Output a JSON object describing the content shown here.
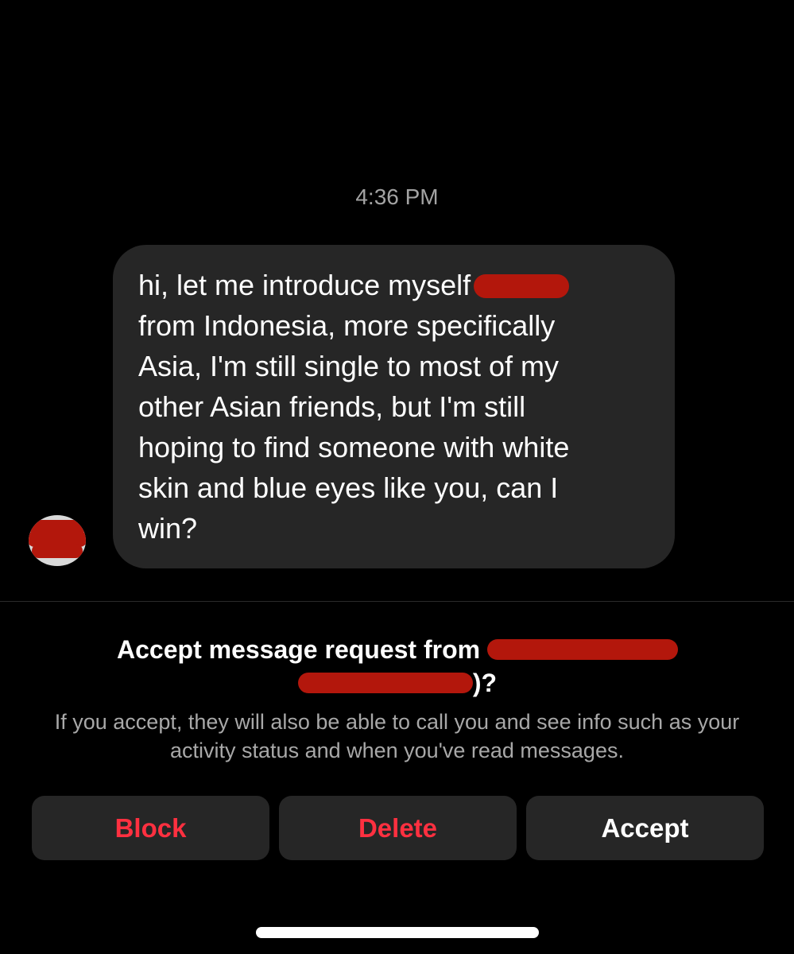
{
  "thread": {
    "timestamp": "4:36 PM",
    "message": {
      "line1": "hi, let me introduce myself",
      "rest": "from Indonesia, more specifically\nAsia, I'm still single to most of my\nother Asian friends, but I'm still\nhoping to find someone with white\nskin and blue eyes like you, can I\nwin?"
    }
  },
  "request": {
    "title_prefix": "Accept message request from",
    "title_suffix": ")?",
    "description": "If you accept, they will also be able to call you and see info such as your activity status and when you've read messages."
  },
  "actions": {
    "block_label": "Block",
    "delete_label": "Delete",
    "accept_label": "Accept"
  },
  "colors": {
    "background": "#000000",
    "bubble": "#262626",
    "danger": "#ff3040",
    "redaction": "#b3170c"
  }
}
